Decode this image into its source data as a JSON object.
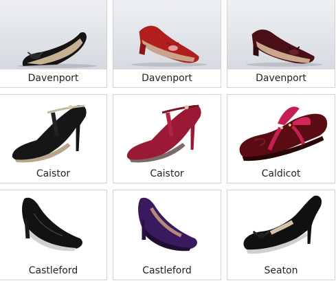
{
  "products": [
    {
      "name": "Davenport",
      "image": "black-patent-peep-toe-wedge",
      "color": "#141414"
    },
    {
      "name": "Davenport",
      "image": "red-patent-peep-toe-wedge",
      "color": "#b01e1e"
    },
    {
      "name": "Davenport",
      "image": "burgundy-patent-peep-toe-wedge",
      "color": "#4a1018"
    },
    {
      "name": "Caistor",
      "image": "black-suede-t-bar-heel",
      "color": "#161616"
    },
    {
      "name": "Caistor",
      "image": "red-suede-t-bar-heel",
      "color": "#9a1a36"
    },
    {
      "name": "Caldicot",
      "image": "burgundy-patent-lace-up-shoe",
      "color": "#5a0c12"
    },
    {
      "name": "Castleford",
      "image": "black-leather-court-shoe",
      "color": "#121212"
    },
    {
      "name": "Castleford",
      "image": "purple-suede-court-shoe",
      "color": "#3a1a5e"
    },
    {
      "name": "Seaton",
      "image": "black-patent-bow-court-shoe",
      "color": "#101010"
    }
  ]
}
